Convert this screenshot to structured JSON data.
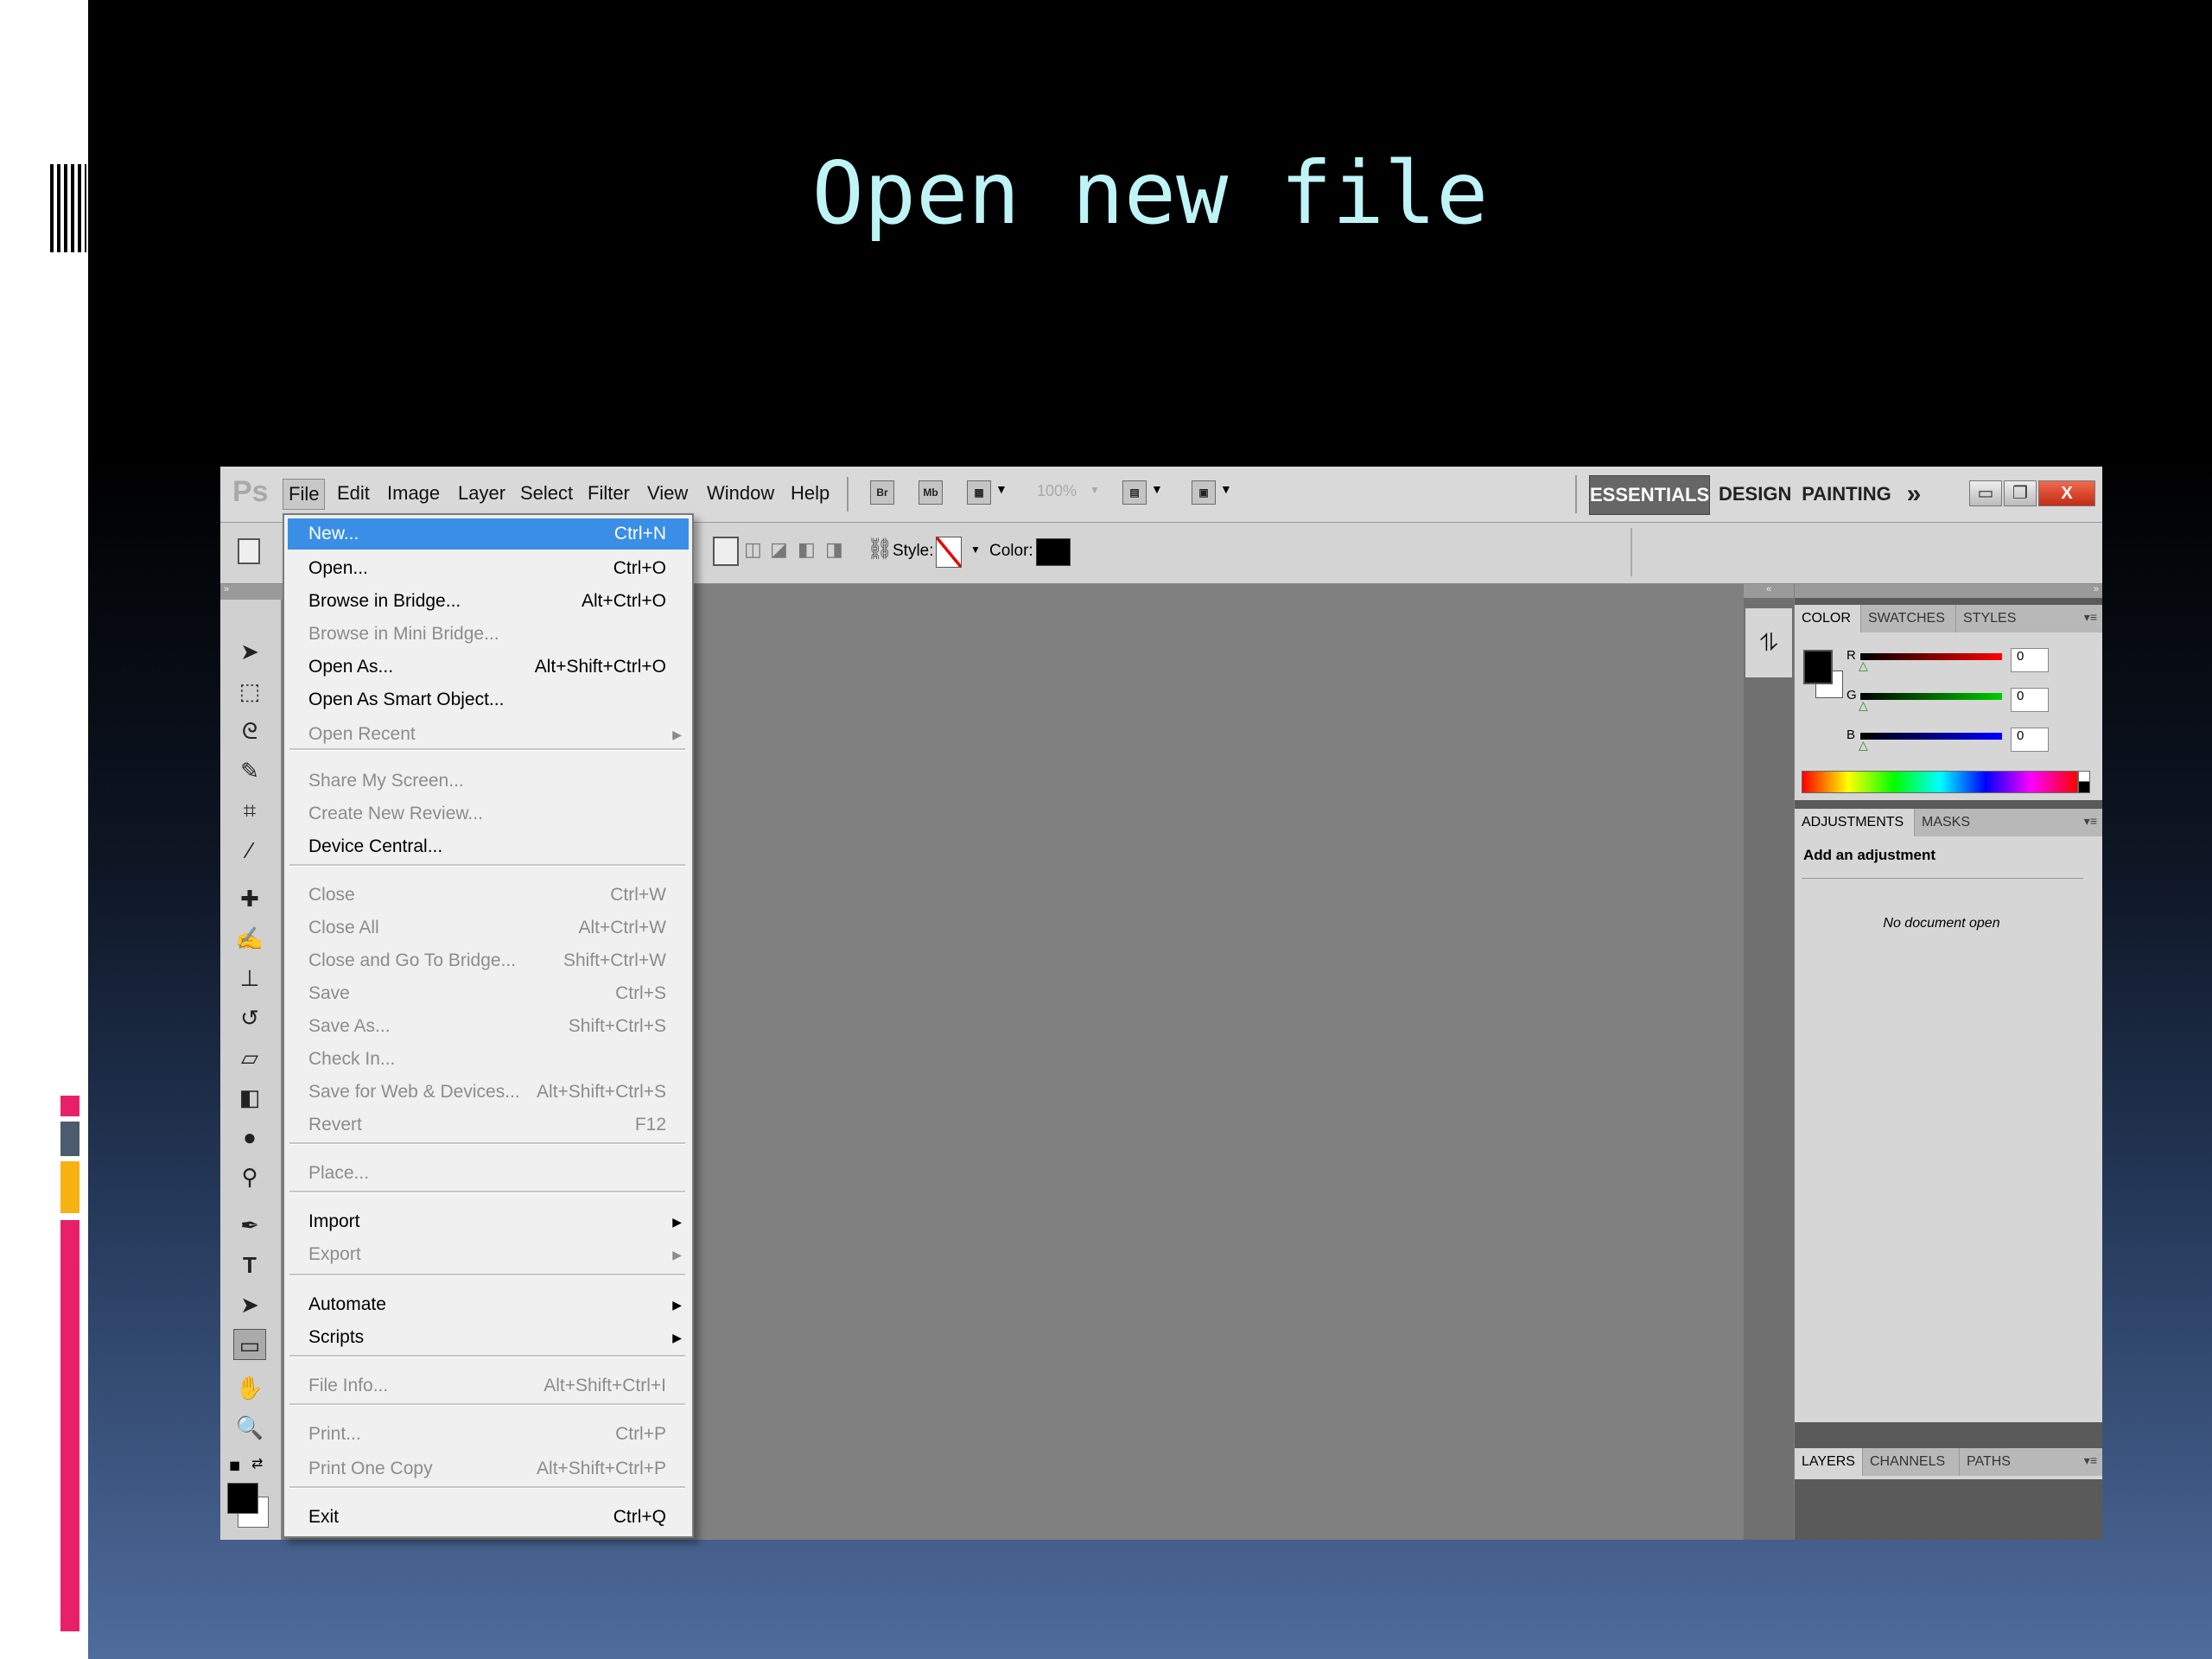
{
  "slide": {
    "title": "Open new file"
  },
  "app": {
    "logo": "Ps",
    "menubar": [
      "File",
      "Edit",
      "Image",
      "Layer",
      "Select",
      "Filter",
      "View",
      "Window",
      "Help"
    ],
    "bar_icons": {
      "bridge": "Br",
      "mini_bridge": "Mb"
    },
    "zoom": "100%",
    "workspaces": [
      "ESSENTIALS",
      "DESIGN",
      "PAINTING"
    ],
    "workspace_more": "»",
    "options_bar": {
      "style_label": "Style:",
      "color_label": "Color:"
    }
  },
  "file_menu": {
    "items": [
      {
        "label": "New...",
        "shortcut": "Ctrl+N",
        "enabled": true,
        "highlighted": true
      },
      {
        "label": "Open...",
        "shortcut": "Ctrl+O",
        "enabled": true
      },
      {
        "label": "Browse in Bridge...",
        "shortcut": "Alt+Ctrl+O",
        "enabled": true
      },
      {
        "label": "Browse in Mini Bridge...",
        "shortcut": "",
        "enabled": false
      },
      {
        "label": "Open As...",
        "shortcut": "Alt+Shift+Ctrl+O",
        "enabled": true
      },
      {
        "label": "Open As Smart Object...",
        "shortcut": "",
        "enabled": true
      },
      {
        "label": "Open Recent",
        "shortcut": "",
        "enabled": false,
        "submenu": true
      },
      {
        "label": "Share My Screen...",
        "shortcut": "",
        "enabled": false
      },
      {
        "label": "Create New Review...",
        "shortcut": "",
        "enabled": false
      },
      {
        "label": "Device Central...",
        "shortcut": "",
        "enabled": true
      },
      {
        "label": "Close",
        "shortcut": "Ctrl+W",
        "enabled": false
      },
      {
        "label": "Close All",
        "shortcut": "Alt+Ctrl+W",
        "enabled": false
      },
      {
        "label": "Close and Go To Bridge...",
        "shortcut": "Shift+Ctrl+W",
        "enabled": false
      },
      {
        "label": "Save",
        "shortcut": "Ctrl+S",
        "enabled": false
      },
      {
        "label": "Save As...",
        "shortcut": "Shift+Ctrl+S",
        "enabled": false
      },
      {
        "label": "Check In...",
        "shortcut": "",
        "enabled": false
      },
      {
        "label": "Save for Web & Devices...",
        "shortcut": "Alt+Shift+Ctrl+S",
        "enabled": false
      },
      {
        "label": "Revert",
        "shortcut": "F12",
        "enabled": false
      },
      {
        "label": "Place...",
        "shortcut": "",
        "enabled": false
      },
      {
        "label": "Import",
        "shortcut": "",
        "enabled": true,
        "submenu": true
      },
      {
        "label": "Export",
        "shortcut": "",
        "enabled": false,
        "submenu": true
      },
      {
        "label": "Automate",
        "shortcut": "",
        "enabled": true,
        "submenu": true
      },
      {
        "label": "Scripts",
        "shortcut": "",
        "enabled": true,
        "submenu": true
      },
      {
        "label": "File Info...",
        "shortcut": "Alt+Shift+Ctrl+I",
        "enabled": false
      },
      {
        "label": "Print...",
        "shortcut": "Ctrl+P",
        "enabled": false
      },
      {
        "label": "Print One Copy",
        "shortcut": "Alt+Shift+Ctrl+P",
        "enabled": false
      },
      {
        "label": "Exit",
        "shortcut": "Ctrl+Q",
        "enabled": true
      }
    ]
  },
  "color_panel": {
    "tabs": [
      "COLOR",
      "SWATCHES",
      "STYLES"
    ],
    "channels": [
      {
        "label": "R",
        "value": "0",
        "color": "#ff0000"
      },
      {
        "label": "G",
        "value": "0",
        "color": "#00cc00"
      },
      {
        "label": "B",
        "value": "0",
        "color": "#0000ff"
      }
    ]
  },
  "adjustments_panel": {
    "tabs": [
      "ADJUSTMENTS",
      "MASKS"
    ],
    "heading": "Add an adjustment",
    "empty_text": "No document open"
  },
  "layers_panel": {
    "tabs": [
      "LAYERS",
      "CHANNELS",
      "PATHS"
    ]
  }
}
